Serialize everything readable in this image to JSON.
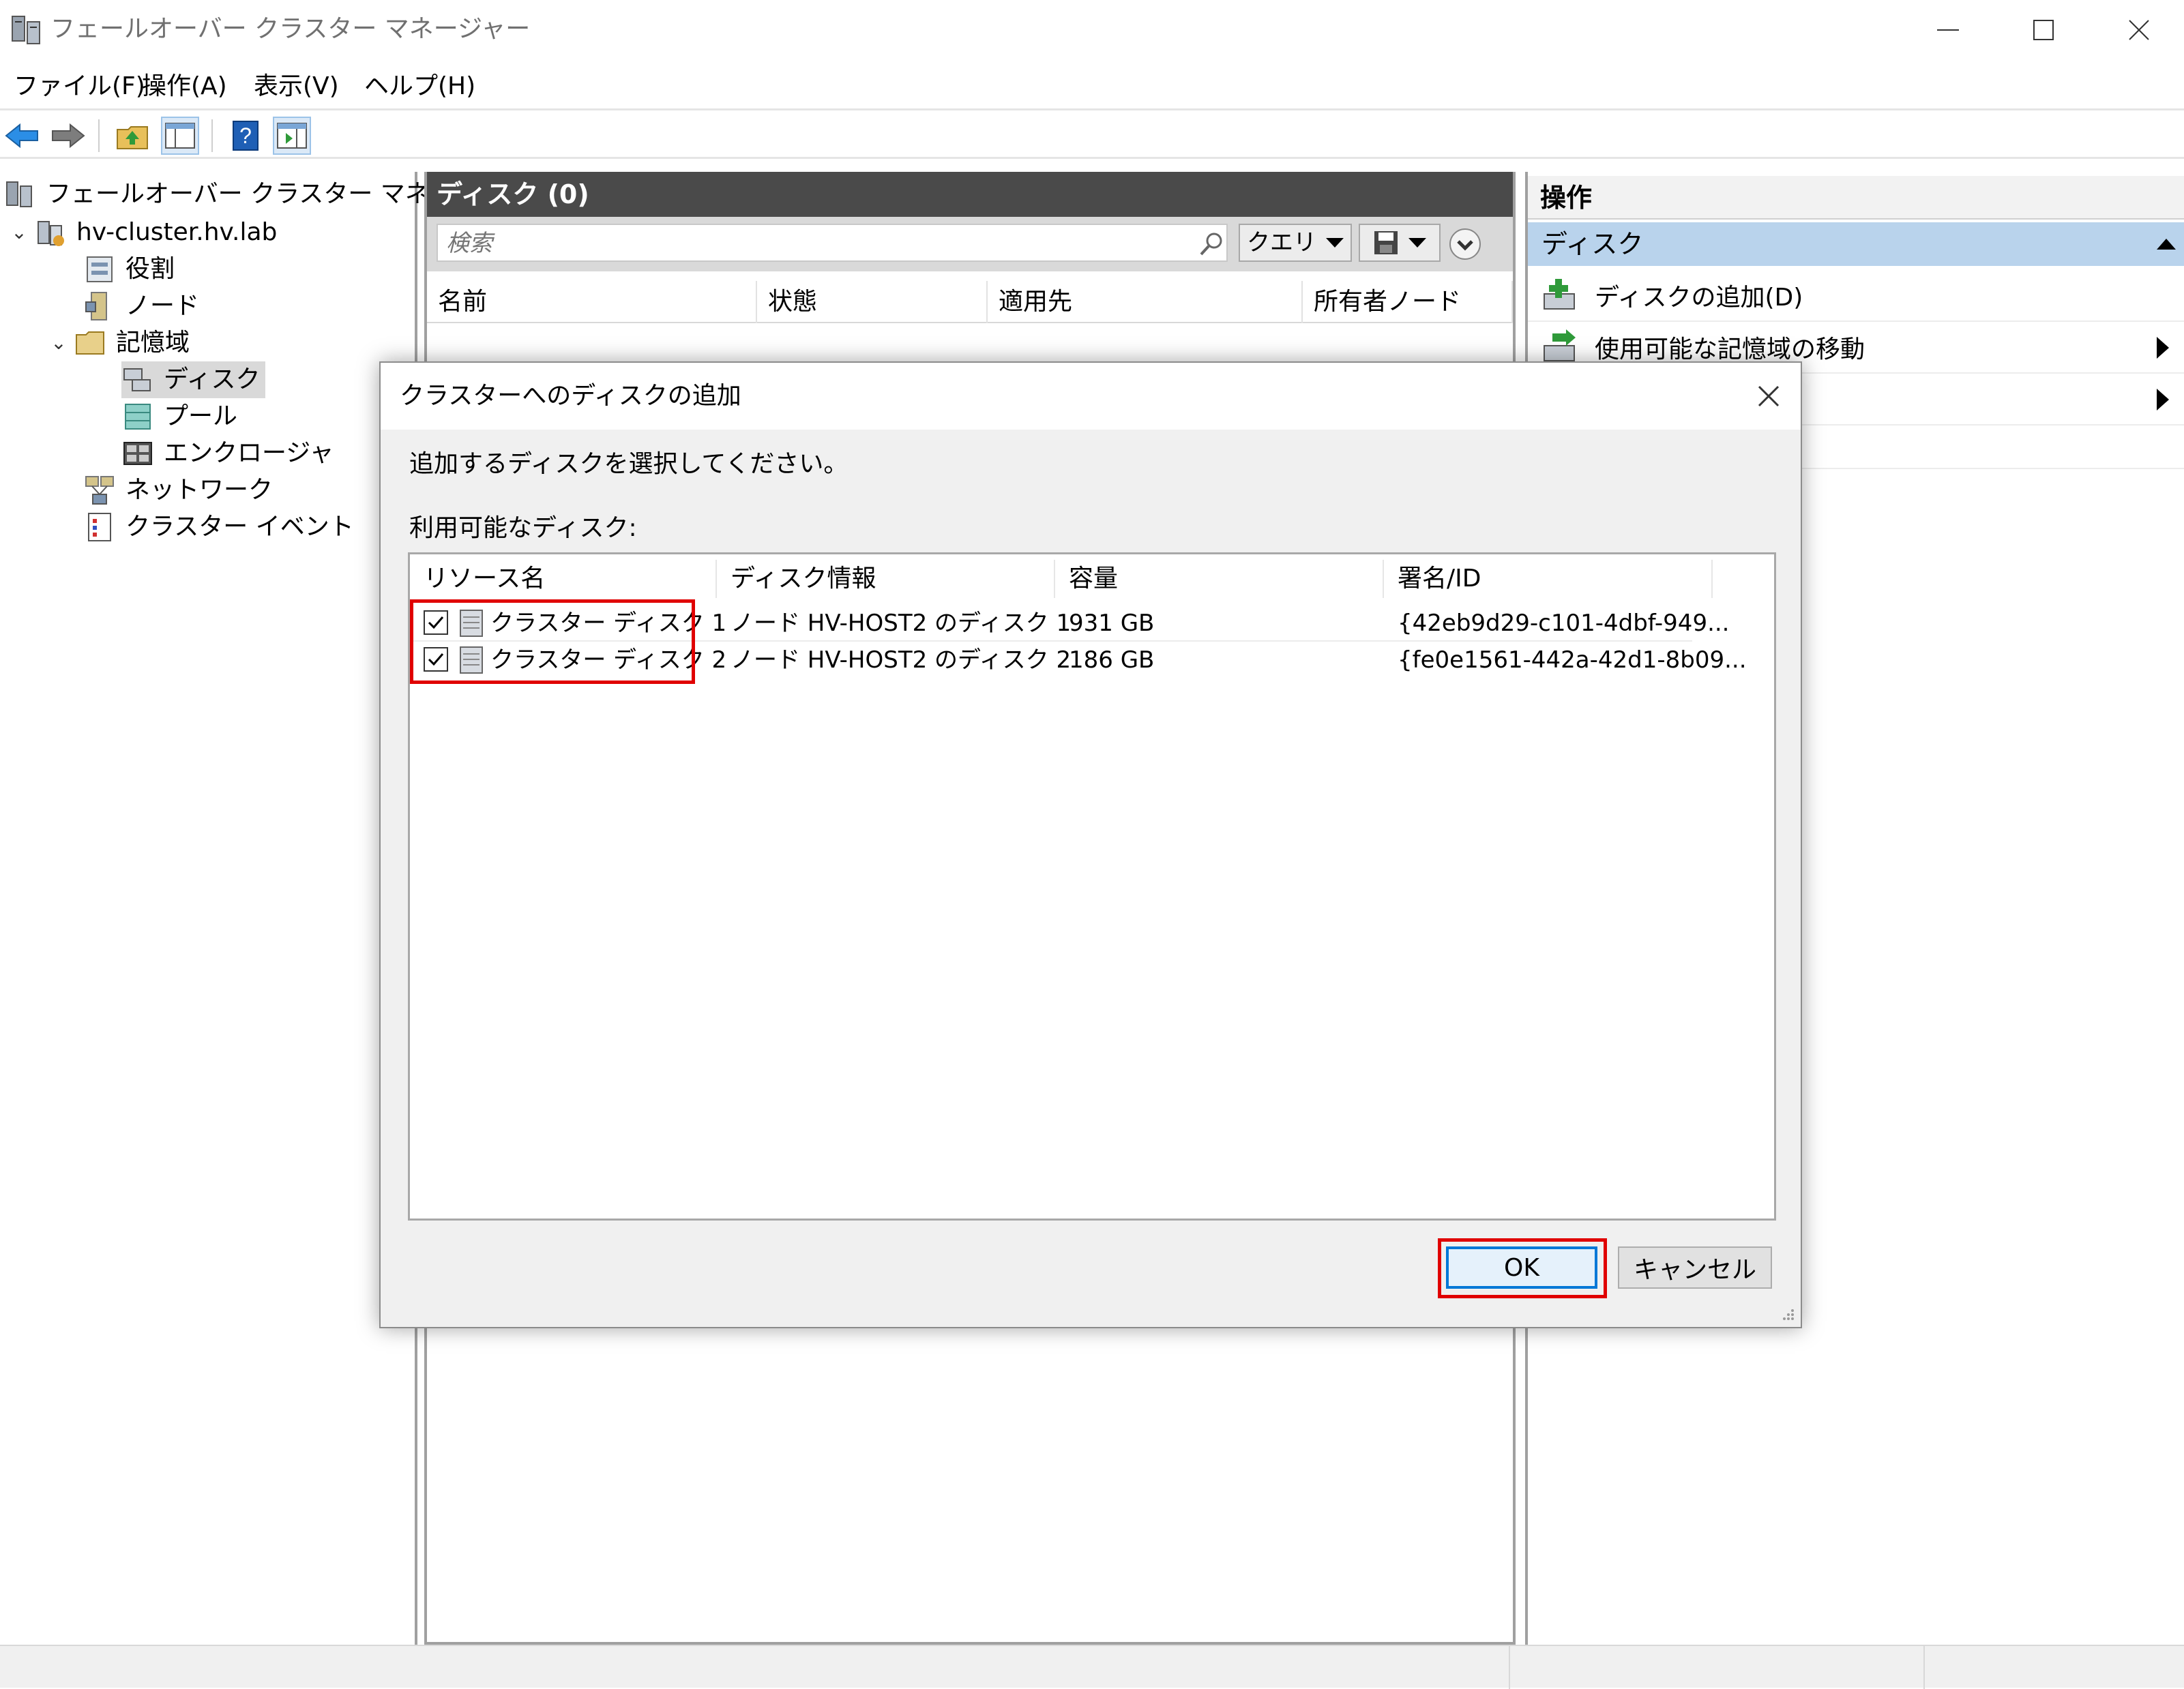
{
  "window": {
    "title": "フェールオーバー クラスター マネージャー",
    "controls": {
      "minimize": "—",
      "maximize": "☐",
      "close": "✕"
    }
  },
  "menu": {
    "file": "ファイル(F)",
    "action": "操作(A)",
    "view": "表示(V)",
    "help": "ヘルプ(H)"
  },
  "toolbar": {
    "icons": [
      "back-arrow-icon",
      "forward-arrow-icon",
      "folder-up-icon",
      "show-hide-tree-icon",
      "help-icon",
      "show-hide-action-icon"
    ]
  },
  "tree": {
    "root": "フェールオーバー クラスター マネージャー",
    "cluster": "hv-cluster.hv.lab",
    "roles": "役割",
    "nodes": "ノード",
    "storage": "記憶域",
    "disks": "ディスク",
    "pools": "プール",
    "enclosures": "エンクロージャ",
    "networks": "ネットワーク",
    "cluster_events": "クラスター イベント",
    "expanded_glyph": "⌄"
  },
  "center": {
    "header": "ディスク (0)",
    "search_placeholder": "検索",
    "query_label": "クエリ",
    "columns": [
      "名前",
      "状態",
      "適用先",
      "所有者ノード"
    ]
  },
  "actions": {
    "header": "操作",
    "section": "ディスク",
    "items": [
      "ディスクの追加(D)",
      "使用可能な記憶域の移動"
    ]
  },
  "dialog": {
    "title": "クラスターへのディスクの追加",
    "instruction": "追加するディスクを選択してください。",
    "available_label": "利用可能なディスク:",
    "columns": [
      "リソース名",
      "ディスク情報",
      "容量",
      "署名/ID"
    ],
    "disks": [
      {
        "name": "クラスター ディスク 1",
        "info": "ノード HV-HOST2 のディスク 1",
        "capacity": "931 GB",
        "signature": "{42eb9d29-c101-4dbf-949...",
        "checked": true
      },
      {
        "name": "クラスター ディスク 2",
        "info": "ノード HV-HOST2 のディスク 2",
        "capacity": "186 GB",
        "signature": "{fe0e1561-442a-42d1-8b09...",
        "checked": true
      }
    ],
    "ok_label": "OK",
    "cancel_label": "キャンセル"
  },
  "colors": {
    "highlight": "#e00000",
    "ok_focus": "#0078d7",
    "section_bg": "#b9d3ec",
    "center_header_bg": "#4a4a4a"
  }
}
